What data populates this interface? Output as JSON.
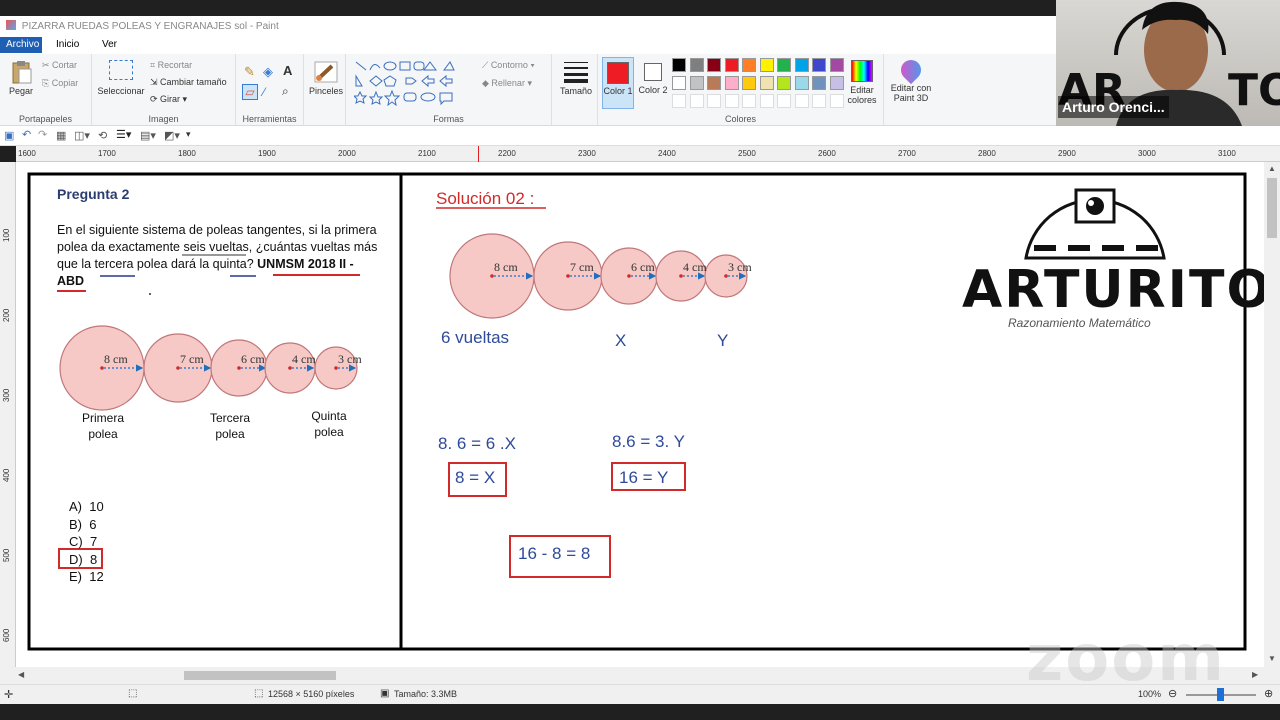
{
  "app": {
    "title": "PIZARRA RUEDAS POLEAS Y ENGRANAJES sol - Paint"
  },
  "menu": {
    "file": "Archivo",
    "home": "Inicio",
    "view": "Ver"
  },
  "ribbon": {
    "clipboard": {
      "label": "Portapapeles",
      "paste": "Pegar",
      "cut": "Cortar",
      "copy": "Copiar"
    },
    "image": {
      "label": "Imagen",
      "select": "Seleccionar",
      "crop": "Recortar",
      "resize": "Cambiar tamaño",
      "rotate": "Girar"
    },
    "tools": {
      "label": "Herramientas"
    },
    "brushes": "Pinceles",
    "shapes": {
      "label": "Formas",
      "outline": "Contorno",
      "fill": "Rellenar"
    },
    "size": "Tamaño",
    "colors": {
      "label": "Colores",
      "color1": "Color 1",
      "color2": "Color 2",
      "color1_value": "#ee1c24",
      "edit": "Editar colores",
      "paint3d": "Editar con Paint 3D",
      "palette": [
        "#000000",
        "#7f7f7f",
        "#880015",
        "#ed1c24",
        "#ff7f27",
        "#fff200",
        "#22b14c",
        "#00a2e8",
        "#3f48cc",
        "#a349a4",
        "#ffffff",
        "#c3c3c3",
        "#b97a57",
        "#ffaec9",
        "#ffc90e",
        "#efe4b0",
        "#b5e61d",
        "#99d9ea",
        "#7092be",
        "#c8bfe7"
      ]
    }
  },
  "ruler": {
    "h_ticks": [
      "1600",
      "1700",
      "1800",
      "1900",
      "2000",
      "2100",
      "2200",
      "2300",
      "2400",
      "2500",
      "2600",
      "2700",
      "2800",
      "2900",
      "3000",
      "3100"
    ],
    "v_ticks": [
      "100",
      "200",
      "300",
      "400",
      "500",
      "600"
    ]
  },
  "question": {
    "title": "Pregunta 2",
    "line1": "En el siguiente sistema de poleas tangentes, si la primera",
    "line2": "polea da exactamente seis vueltas, ¿cuántas vueltas más",
    "line3": "que la tercera polea dará la quinta?",
    "source": "UNMSM 2018 II -",
    "source2": "ABD",
    "pulleys": [
      "8 cm",
      "7 cm",
      "6 cm",
      "4 cm",
      "3 cm"
    ],
    "label_first": "Primera",
    "label_first2": "polea",
    "label_third": "Tercera",
    "label_third2": "polea",
    "label_fifth": "Quinta",
    "label_fifth2": "polea",
    "options": [
      "A)  10",
      "B)  6",
      "C)  7",
      "D)  8",
      "E)  12"
    ]
  },
  "solution": {
    "title": "Solución 02 :",
    "pulleys": [
      "8 cm",
      "7 cm",
      "6 cm",
      "4 cm",
      "3 cm"
    ],
    "turns": "6 vueltas",
    "x": "X",
    "y": "Y",
    "eq1": "8. 6 = 6 .X",
    "eq2": "8.6 = 3. Y",
    "res1": "8 = X",
    "res2": "16 = Y",
    "final": "16 - 8 = 8"
  },
  "logo": {
    "name": "ARTURITO",
    "subtitle": "Razonamiento Matemático"
  },
  "status": {
    "dimensions": "12568 × 5160 píxeles",
    "size": "Tamaño: 3.3MB",
    "zoom": "100%"
  },
  "video": {
    "participant": "Arturo Orenci..."
  },
  "watermark": "zoom"
}
